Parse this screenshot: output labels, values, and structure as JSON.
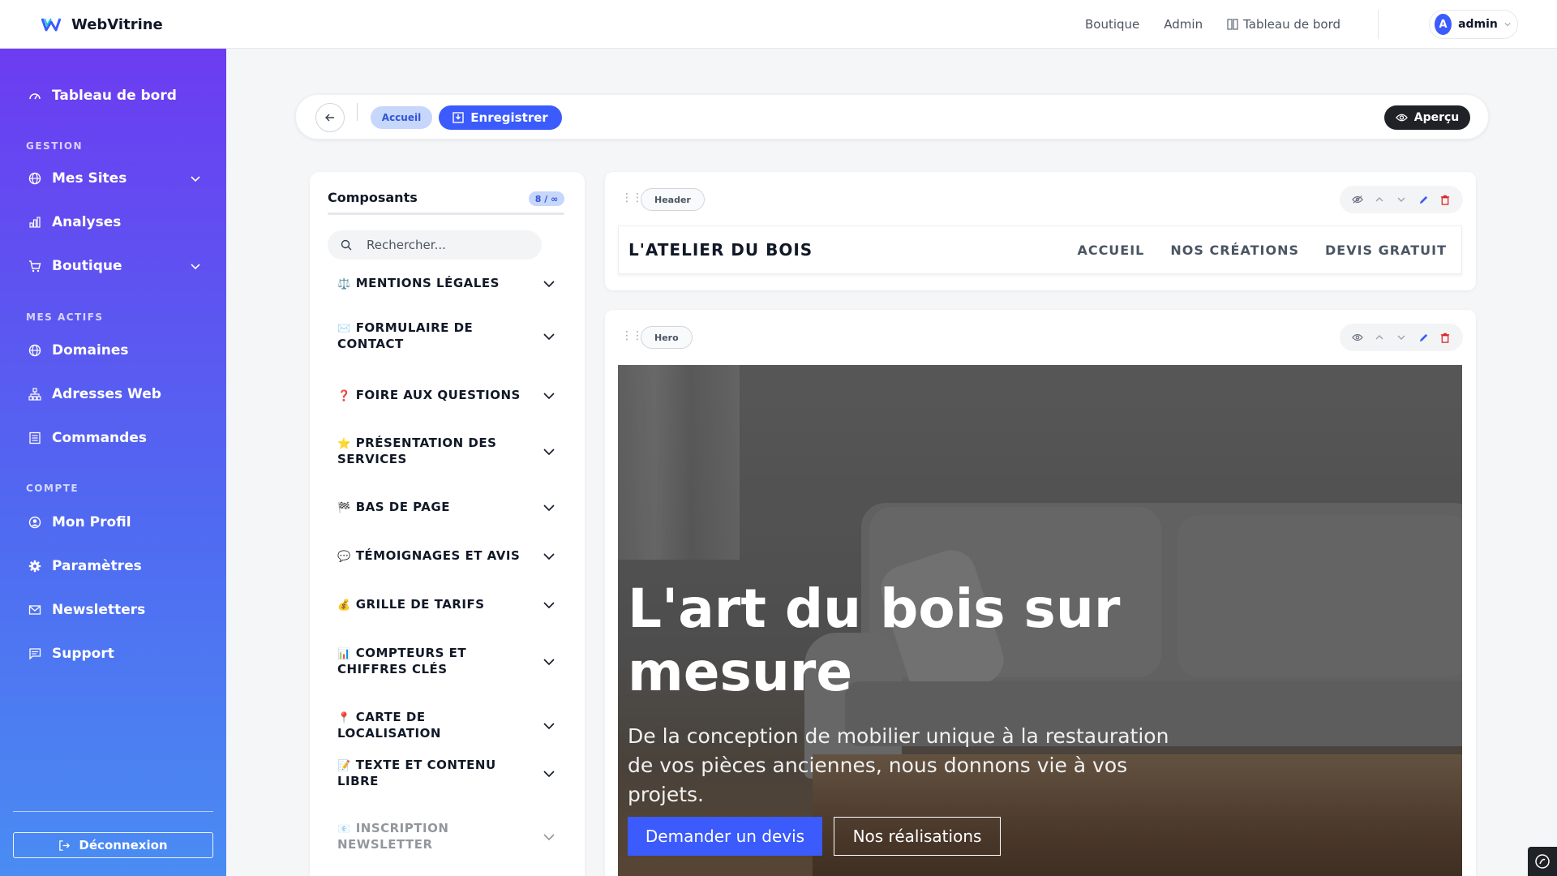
{
  "app": {
    "name": "WebVitrine"
  },
  "topnav": {
    "shop": "Boutique",
    "admin": "Admin",
    "dashboard": "Tableau de bord",
    "user": "admin",
    "avatar_initial": "A"
  },
  "sidebar": {
    "dashboard": "Tableau de bord",
    "section_gestion": "GESTION",
    "my_sites": "Mes Sites",
    "analyses": "Analyses",
    "shop": "Boutique",
    "section_actifs": "MES ACTIFS",
    "domains": "Domaines",
    "web_addresses": "Adresses Web",
    "orders": "Commandes",
    "section_compte": "COMPTE",
    "profile": "Mon Profil",
    "settings": "Paramètres",
    "newsletters": "Newsletters",
    "support": "Support",
    "logout": "Déconnexion"
  },
  "toolbar": {
    "page_pill": "Accueil",
    "save": "Enregistrer",
    "preview": "Aperçu"
  },
  "components": {
    "title": "Composants",
    "count": "8 / ∞",
    "search_placeholder": "Rechercher...",
    "items": [
      {
        "emoji": "⚖️",
        "label": "MENTIONS LÉGALES"
      },
      {
        "emoji": "✉️",
        "label": "FORMULAIRE DE CONTACT"
      },
      {
        "emoji": "❓",
        "label": "FOIRE AUX QUESTIONS"
      },
      {
        "emoji": "⭐",
        "label": "PRÉSENTATION DES SERVICES"
      },
      {
        "emoji": "🏁",
        "label": "BAS DE PAGE"
      },
      {
        "emoji": "💬",
        "label": "TÉMOIGNAGES ET AVIS"
      },
      {
        "emoji": "💰",
        "label": "GRILLE DE TARIFS"
      },
      {
        "emoji": "📊",
        "label": "COMPTEURS ET CHIFFRES CLÉS"
      },
      {
        "emoji": "📍",
        "label": "CARTE DE LOCALISATION"
      },
      {
        "emoji": "📝",
        "label": "TEXTE ET CONTENU LIBRE"
      },
      {
        "emoji": "📧",
        "label": "INSCRIPTION NEWSLETTER"
      }
    ]
  },
  "blocks": {
    "header": {
      "tag": "Header",
      "logo": "L'ATELIER DU BOIS",
      "nav": [
        "ACCUEIL",
        "NOS CRÉATIONS",
        "DEVIS GRATUIT"
      ]
    },
    "hero": {
      "tag": "Hero",
      "title": "L'art du bois sur mesure",
      "subtitle": "De la conception de mobilier unique à la restauration de vos pièces anciennes, nous donnons vie à vos projets.",
      "primary_cta": "Demander un devis",
      "secondary_cta": "Nos réalisations"
    }
  },
  "colors": {
    "accent": "#3b5bfc",
    "sidebar_top": "#6c3cf1",
    "sidebar_bottom": "#4a8cf3",
    "danger": "#dc2626"
  }
}
